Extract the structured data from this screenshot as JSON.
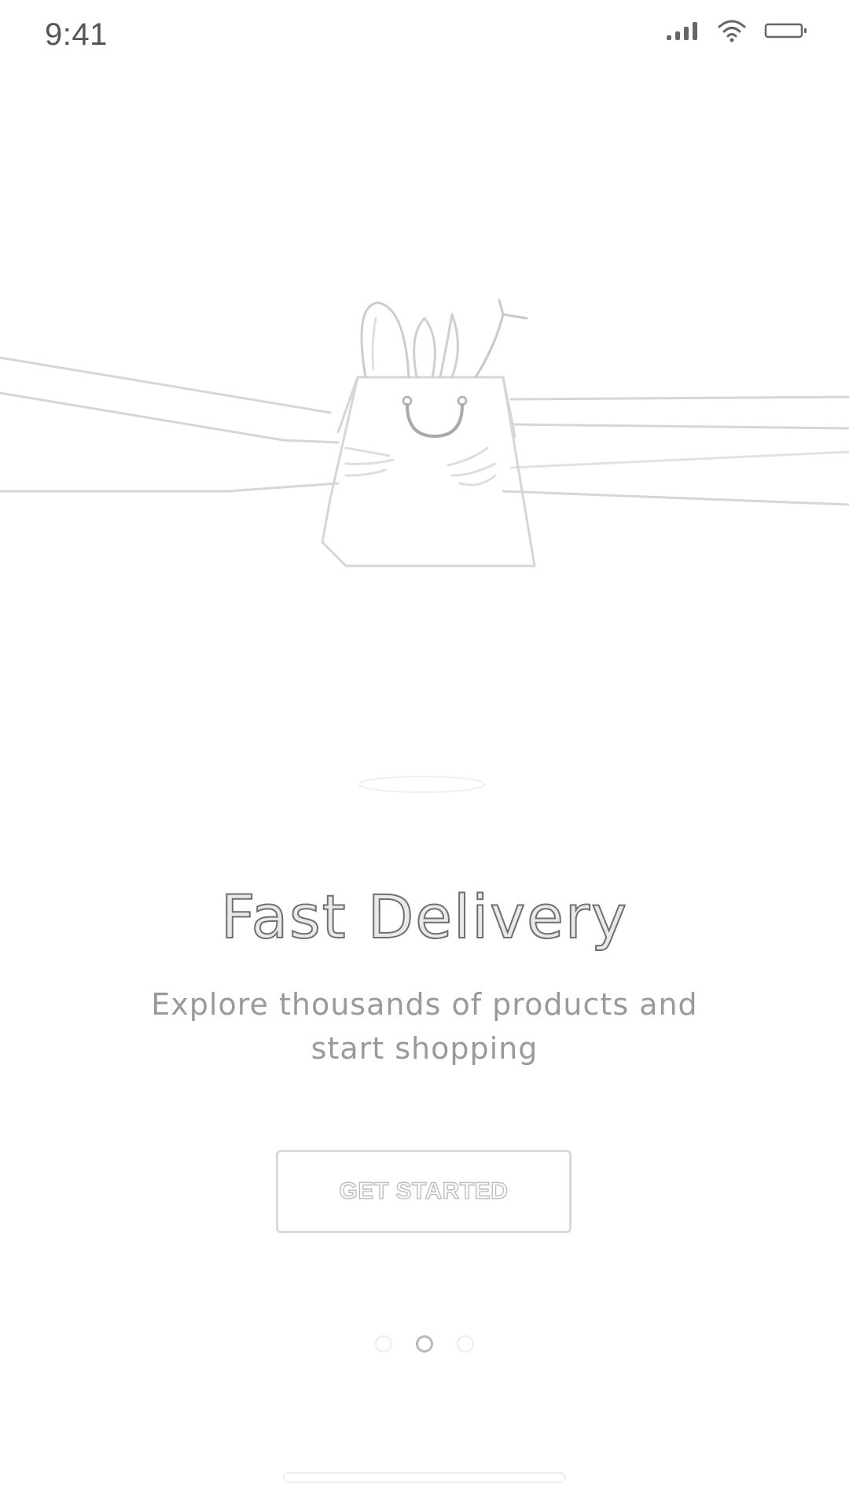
{
  "status_bar": {
    "time": "9:41",
    "icons": [
      "signal-icon",
      "wifi-icon",
      "battery-icon"
    ]
  },
  "onboarding": {
    "illustration": "shopping-bag-hands-illustration",
    "title": "Fast Delivery",
    "subtitle": "Explore thousands of products and start shopping",
    "button_label": "GET STARTED",
    "pager": {
      "pages": 3,
      "active_index": 1
    }
  },
  "colors": {
    "background": "#ffffff",
    "title_outline": "#6f6f6f",
    "subtitle": "#9a9a9a",
    "button_border": "#d9d9d9"
  }
}
